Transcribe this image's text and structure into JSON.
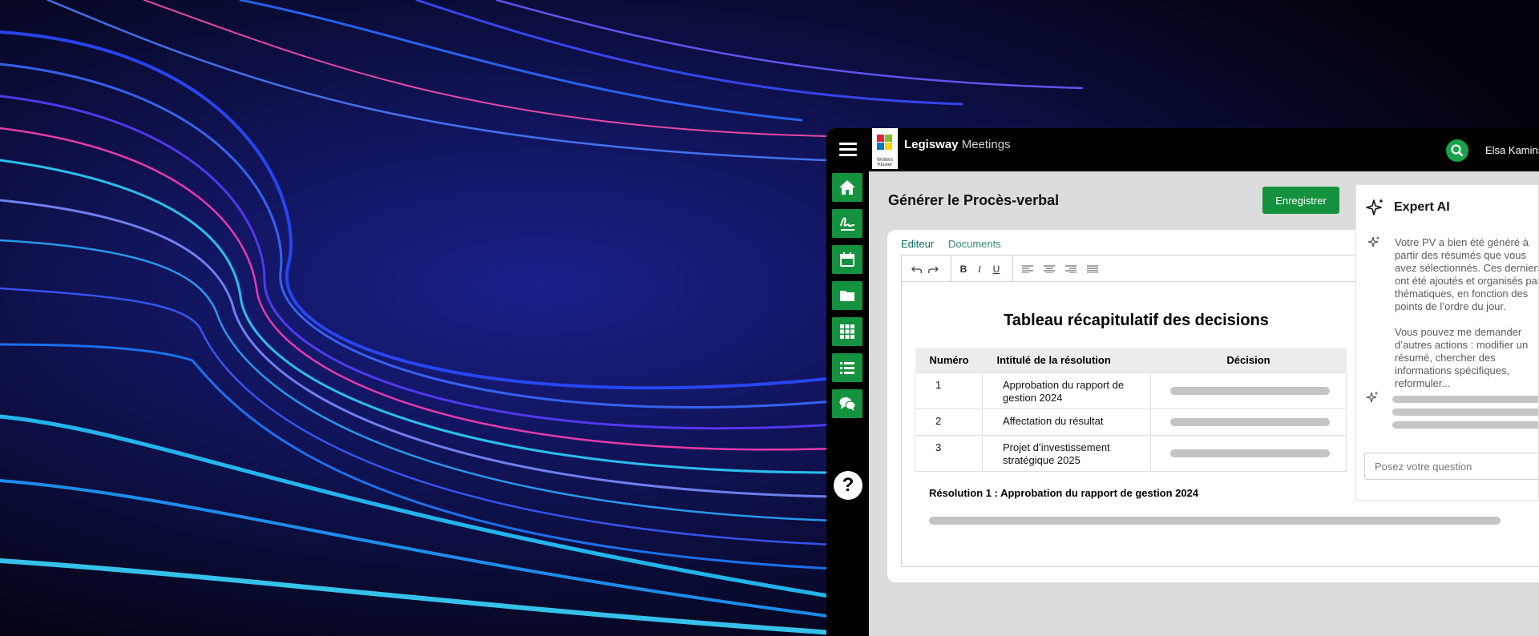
{
  "app": {
    "brand_bold": "Legisway",
    "brand_light": "Meetings",
    "logo_text": "Wolters Kluwer",
    "user_name": "Elsa Kamins"
  },
  "icons": {
    "menu": "hamburger-icon",
    "search": "search-icon",
    "nav": [
      "home-icon",
      "signature-icon",
      "calendar-icon",
      "folder-icon",
      "grid-icon",
      "list-icon",
      "chat-icon"
    ],
    "help": "?"
  },
  "colors": {
    "accent": "#15923e",
    "tab": "#0f6d6d",
    "topbar": "#000000"
  },
  "page": {
    "title": "Générer le Procès-verbal",
    "save_label": "Enregistrer"
  },
  "tabs": [
    "Editeur",
    "Documents"
  ],
  "toolbar": {
    "bold": "B",
    "italic": "I",
    "underline": "U"
  },
  "document": {
    "title": "Tableau récapitulatif des decisions",
    "table": {
      "headers": [
        "Numéro",
        "Intitulé de la résolution",
        "Décision"
      ],
      "rows": [
        {
          "num": "1",
          "title": "Approbation du rapport de gestion 2024"
        },
        {
          "num": "2",
          "title": "Affectation du résultat"
        },
        {
          "num": "3",
          "title": "Projet d’investissement stratégique 2025"
        }
      ]
    },
    "resolution_title": "Résolution 1 : Approbation du rapport de gestion 2024"
  },
  "ai": {
    "title": "Expert AI",
    "message1": "Votre PV a bien été généré à partir des résumés que vous avez sélectionnés. Ces derniers ont été ajoutés et organisés par thématiques, en fonction des points de l’ordre du jour.",
    "message2": "Vous pouvez me demander d’autres actions : modifier un résumé, chercher des informations spécifiques, reformuler...",
    "input_placeholder": "Posez votre question"
  }
}
